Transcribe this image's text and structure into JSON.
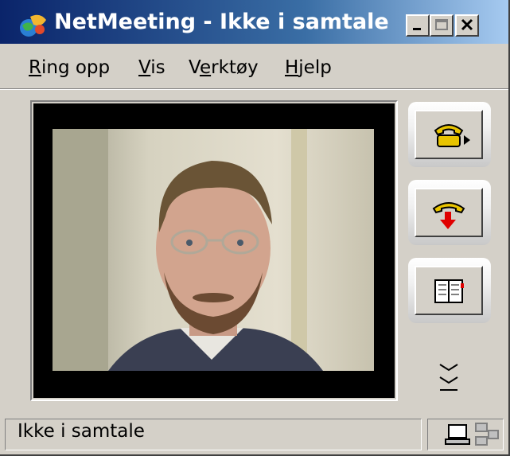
{
  "window": {
    "title": "NetMeeting - Ikke i samtale",
    "buttons": [
      "minimize",
      "maximize",
      "close"
    ]
  },
  "menubar": {
    "items": [
      {
        "underline": "R",
        "rest": "ing opp"
      },
      {
        "underline": "V",
        "rest": "is"
      },
      {
        "pre": "V",
        "underline": "e",
        "rest": "rktøy"
      },
      {
        "underline": "H",
        "rest": "jelp"
      }
    ]
  },
  "toolbar": {
    "buttons": [
      {
        "name": "call-button",
        "icon": "phone-icon"
      },
      {
        "name": "hang-up-button",
        "icon": "hang-up-icon"
      },
      {
        "name": "directory-button",
        "icon": "address-book-icon"
      }
    ]
  },
  "status": {
    "text": "Ikke i samtale",
    "icons": [
      "computer-icon",
      "network-icon"
    ]
  },
  "colors": {
    "title_start": "#0a246a",
    "title_end": "#a6caf0",
    "face": "#d4d0c8"
  }
}
